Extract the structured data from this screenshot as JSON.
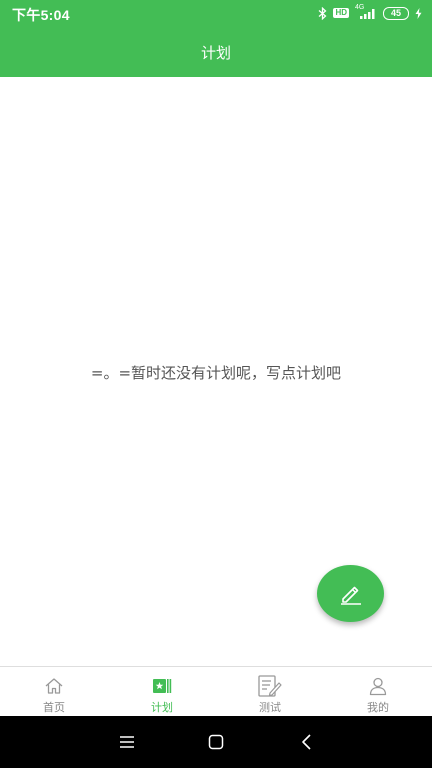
{
  "status_bar": {
    "time": "下午5:04",
    "network_label": "4G",
    "hd_label": "HD",
    "battery": "45"
  },
  "header": {
    "title": "计划"
  },
  "main": {
    "empty_message": "=。=暂时还没有计划呢，写点计划吧"
  },
  "fab": {
    "icon": "pencil-icon"
  },
  "bottom_nav": {
    "items": [
      {
        "label": "首页",
        "icon": "home-icon",
        "active": false
      },
      {
        "label": "计划",
        "icon": "plan-icon",
        "active": true
      },
      {
        "label": "测试",
        "icon": "test-icon",
        "active": false
      },
      {
        "label": "我的",
        "icon": "profile-icon",
        "active": false
      }
    ]
  },
  "colors": {
    "primary": "#43bd55",
    "inactive": "#888888",
    "text": "#555555",
    "system_nav": "#000000"
  }
}
